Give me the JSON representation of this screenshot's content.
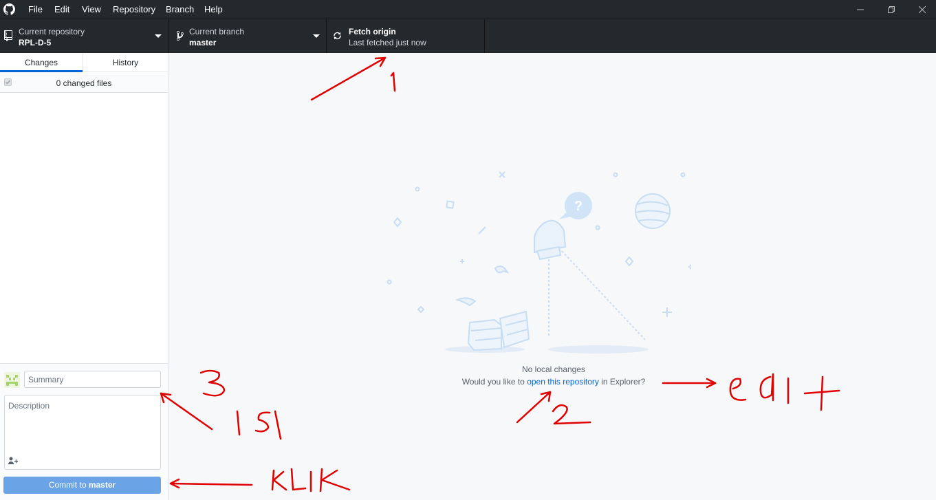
{
  "window": {
    "menu": [
      "File",
      "Edit",
      "View",
      "Repository",
      "Branch",
      "Help"
    ]
  },
  "toolbar": {
    "repository": {
      "label": "Current repository",
      "value": "RPL-D-5"
    },
    "branch": {
      "label": "Current branch",
      "value": "master"
    },
    "fetch": {
      "label": "Fetch origin",
      "value": "Last fetched just now"
    }
  },
  "sidebar": {
    "tabs": [
      "Changes",
      "History"
    ],
    "active_tab": "Changes",
    "changed_files": "0 changed files",
    "commit": {
      "summary_placeholder": "Summary",
      "description_placeholder": "Description",
      "button_prefix": "Commit to ",
      "button_branch": "master"
    }
  },
  "main": {
    "title": "No local changes",
    "prompt_before": "Would you like to ",
    "prompt_link": "open this repository",
    "prompt_after": " in Explorer?"
  },
  "annotations": {
    "color": "#e00000",
    "labels": [
      "1",
      "2",
      "3",
      "isi",
      "klik",
      "edit"
    ]
  },
  "colors": {
    "titlebar": "#24292e",
    "accent": "#0366d6",
    "commit_button": "#6aa4e6",
    "main_bg": "#f6f8fa"
  }
}
